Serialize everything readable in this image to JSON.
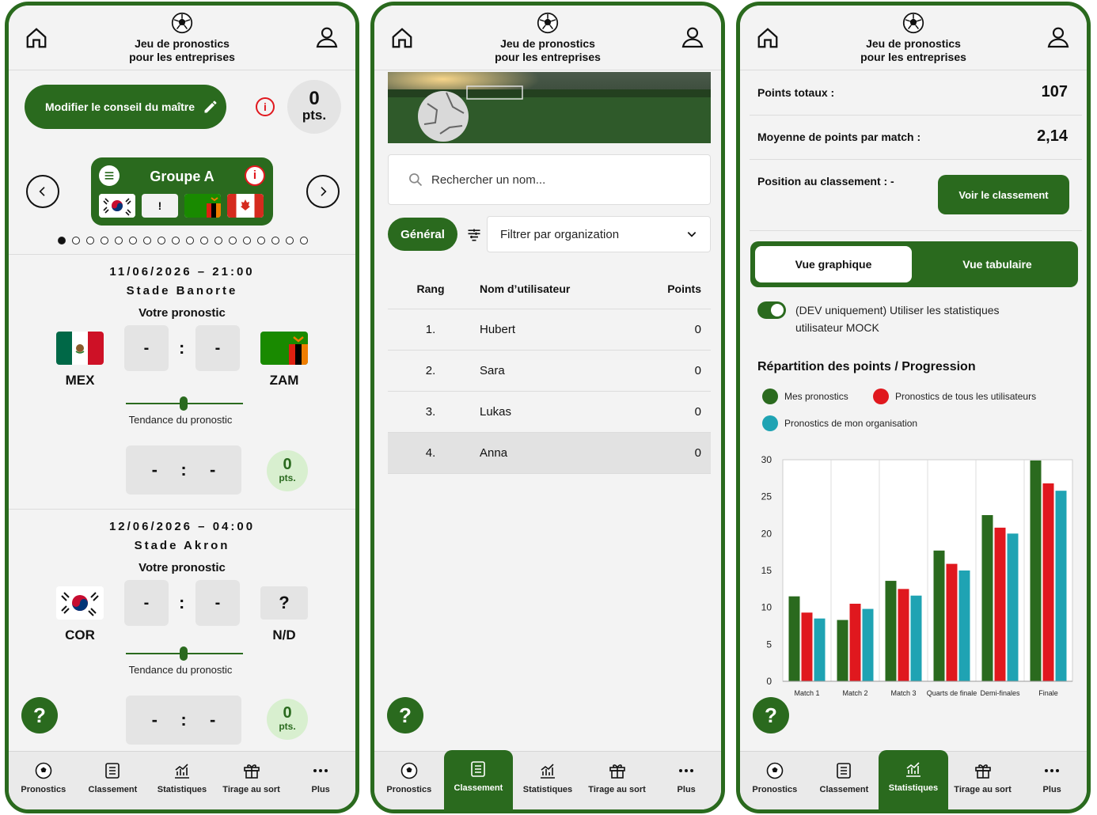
{
  "colors": {
    "primary": "#2a6a1e",
    "red": "#e0181e",
    "teal": "#1fa3b3",
    "light_green": "#d8efcf"
  },
  "header": {
    "title_line1": "Jeu de pronostics",
    "title_line2": "pour les entreprises",
    "icons": [
      "home-icon",
      "soccer-ball-icon",
      "user-icon"
    ]
  },
  "nav": {
    "items": [
      {
        "label": "Pronostics",
        "icon": "soccer-ball-icon"
      },
      {
        "label": "Classement",
        "icon": "list-icon"
      },
      {
        "label": "Statistiques",
        "icon": "chart-icon"
      },
      {
        "label": "Tirage au sort",
        "icon": "gift-icon"
      },
      {
        "label": "Plus",
        "icon": "more-icon"
      }
    ]
  },
  "help": {
    "label": "?"
  },
  "screen1": {
    "modify_label": "Modifier le conseil du maître",
    "info": "i",
    "points": {
      "value": "0",
      "unit": "pts."
    },
    "group": {
      "title": "Groupe A",
      "flags": [
        "KOR",
        "?",
        "ZAM",
        "CAN"
      ],
      "unknown_flag": "!"
    },
    "pager": {
      "total": 18,
      "active": 0
    },
    "matches": [
      {
        "date": "11/06/2026 – 21:00",
        "venue": "Stade Banorte",
        "your_pred": "Votre pronostic",
        "home": "MEX",
        "away": "ZAM",
        "home_score": "-",
        "away_score": "-",
        "sep": ":",
        "trend": "Tendance du pronostic",
        "res_home": "-",
        "res_away": "-",
        "pts": "0",
        "pts_unit": "pts."
      },
      {
        "date": "12/06/2026 – 04:00",
        "venue": "Stade Akron",
        "your_pred": "Votre pronostic",
        "home": "COR",
        "away": "N/D",
        "away_flag": "?",
        "home_score": "-",
        "away_score": "-",
        "sep": ":",
        "trend": "Tendance du pronostic",
        "res_home": "-",
        "res_away": "-",
        "pts": "0",
        "pts_unit": "pts."
      }
    ]
  },
  "screen2": {
    "search_placeholder": "Rechercher un nom...",
    "general": "Général",
    "filter_placeholder": "Filtrer par organization",
    "columns": [
      "Rang",
      "Nom d’utilisateur",
      "Points"
    ],
    "rows": [
      {
        "rank": "1.",
        "name": "Hubert",
        "points": "0"
      },
      {
        "rank": "2.",
        "name": "Sara",
        "points": "0"
      },
      {
        "rank": "3.",
        "name": "Lukas",
        "points": "0"
      },
      {
        "rank": "4.",
        "name": "Anna",
        "points": "0"
      }
    ],
    "active_nav": "Classement"
  },
  "screen3": {
    "total_label": "Points totaux :",
    "total_value": "107",
    "avg_label": "Moyenne de points par match :",
    "avg_value": "2,14",
    "pos_label": "Position au classement : -",
    "voir_label": "Voir le classement",
    "tab1": "Vue graphique",
    "tab2": "Vue tabulaire",
    "dev_text": "(DEV uniquement) Utiliser les statistiques utilisateur MOCK",
    "chart_title": "Répartition des points / Progression",
    "active_nav": "Statistiques"
  },
  "chart_data": {
    "type": "bar",
    "categories": [
      "Match 1",
      "Match 2",
      "Match 3",
      "Quarts de finale",
      "Demi-finales",
      "Finale"
    ],
    "series": [
      {
        "name": "Mes pronostics",
        "color": "#2a6a1e",
        "values": [
          11.5,
          8.3,
          13.6,
          17.7,
          22.5,
          29.9
        ]
      },
      {
        "name": "Pronostics de tous les utilisateurs",
        "color": "#e0181e",
        "values": [
          9.3,
          10.5,
          12.5,
          15.9,
          20.8,
          26.8
        ]
      },
      {
        "name": "Pronostics de mon organisation",
        "color": "#1fa3b3",
        "values": [
          8.5,
          9.8,
          11.6,
          15.0,
          20.0,
          25.8
        ]
      }
    ],
    "ylim": [
      0,
      30
    ],
    "yticks": [
      0,
      5,
      10,
      15,
      20,
      25,
      30
    ],
    "grid": true,
    "legend": "top-left"
  }
}
